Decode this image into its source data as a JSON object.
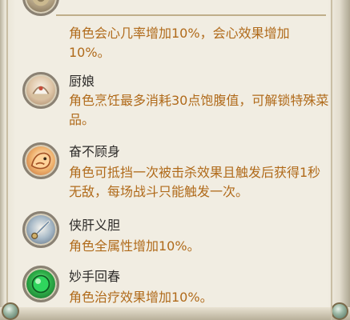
{
  "skills": [
    {
      "name": "",
      "desc": "角色会心几率增加10%，会心效果增加10%。",
      "icon": "crit-talent-icon"
    },
    {
      "name": "厨娘",
      "desc": "角色烹饪最多消耗30点饱腹值，可解锁特殊菜品。",
      "icon": "chef-talent-icon"
    },
    {
      "name": "奋不顾身",
      "desc": "角色可抵挡一次被击杀效果且触发后获得1秒无敌，每场战斗只能触发一次。",
      "icon": "brave-talent-icon"
    },
    {
      "name": "侠肝义胆",
      "desc": "角色全属性增加10%。",
      "icon": "heroic-talent-icon"
    },
    {
      "name": "妙手回春",
      "desc": "角色治疗效果增加10%。",
      "icon": "healing-talent-icon"
    }
  ],
  "colors": {
    "name": "#2c2a28",
    "desc": "#b06a1a",
    "panel": "#f1ede2"
  }
}
